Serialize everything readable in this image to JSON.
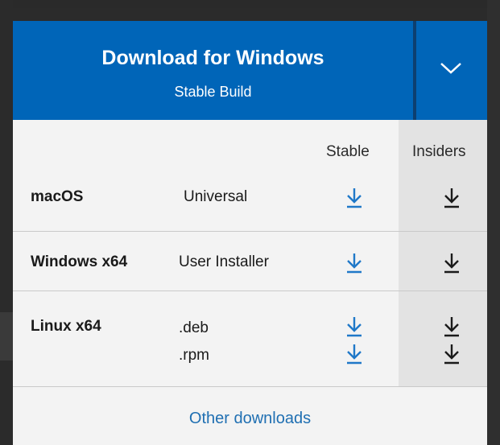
{
  "hero": {
    "title": "Download for Windows",
    "subtitle": "Stable Build"
  },
  "columns": {
    "stable": "Stable",
    "insiders": "Insiders"
  },
  "rows": [
    {
      "os": "macOS",
      "variants": [
        "Universal"
      ]
    },
    {
      "os": "Windows x64",
      "variants": [
        "User Installer"
      ]
    },
    {
      "os": "Linux x64",
      "variants": [
        ".deb",
        ".rpm"
      ]
    }
  ],
  "footer": {
    "other_downloads": "Other downloads"
  },
  "icons": {
    "dropdown": "chevron-down-icon",
    "stable_download": "download-arrow-icon",
    "insiders_download": "download-arrow-icon"
  },
  "colors": {
    "brand": "#0065b8",
    "stable_arrow": "#1f78c8",
    "insiders_arrow": "#1a1a1a",
    "link": "#1f6fb2",
    "insiders_column_bg": "#e3e3e3"
  }
}
